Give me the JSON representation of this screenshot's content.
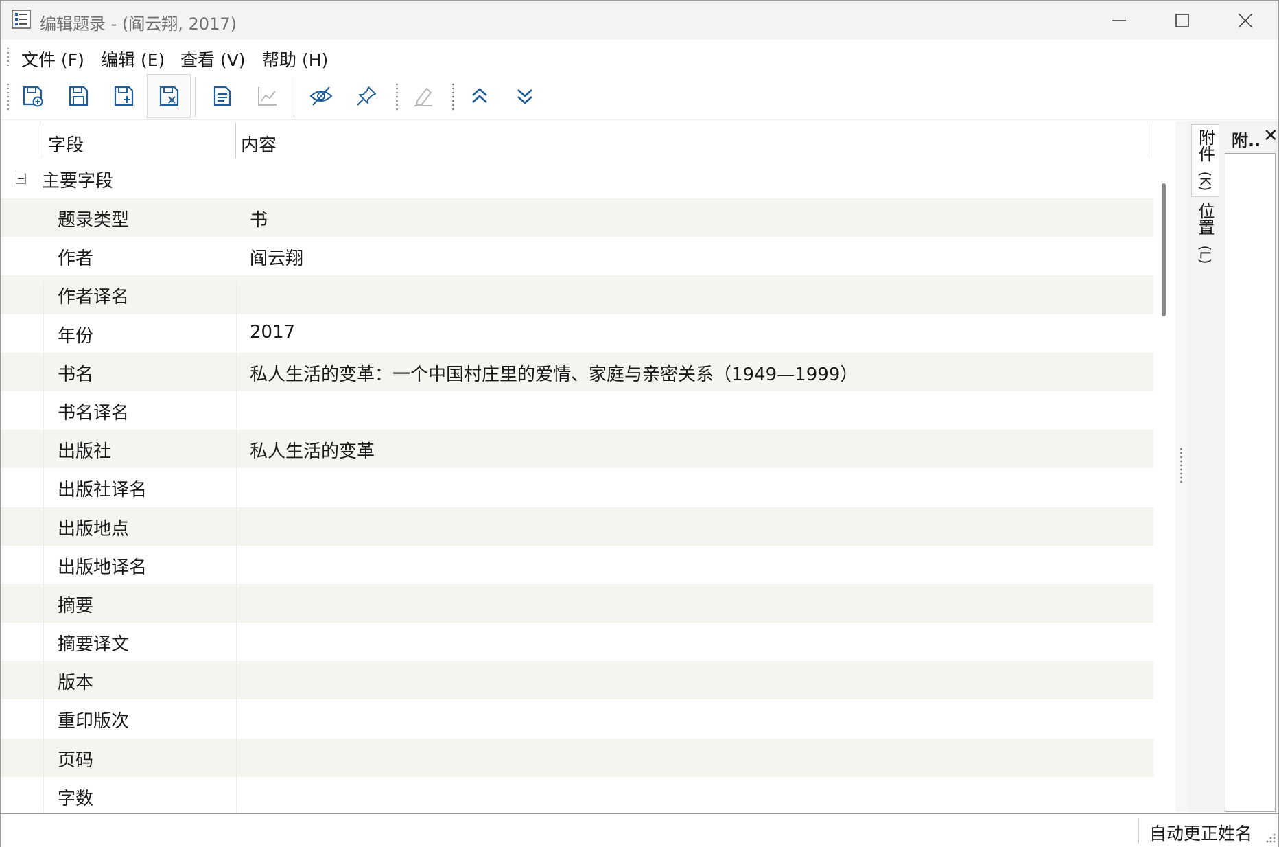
{
  "window": {
    "title": "编辑题录 - (阎云翔, 2017)"
  },
  "menu": {
    "items": [
      "文件 (F)",
      "编辑 (E)",
      "查看 (V)",
      "帮助 (H)"
    ]
  },
  "toolbar": {
    "icons": [
      "save-new-icon",
      "save-icon",
      "save-copy-icon",
      "save-close-icon",
      "record-list-icon",
      "chart-icon",
      "hide-icon",
      "pin-icon",
      "edit-icon",
      "move-up-icon",
      "move-down-icon"
    ]
  },
  "grid": {
    "columns": [
      "字段",
      "内容"
    ],
    "group": "主要字段",
    "rows": [
      {
        "field": "题录类型",
        "value": "书"
      },
      {
        "field": "作者",
        "value": "阎云翔"
      },
      {
        "field": "作者译名",
        "value": ""
      },
      {
        "field": "年份",
        "value": "2017"
      },
      {
        "field": "书名",
        "value": "私人生活的变革：一个中国村庄里的爱情、家庭与亲密关系（1949—1999）"
      },
      {
        "field": "书名译名",
        "value": ""
      },
      {
        "field": "出版社",
        "value": "私人生活的变革"
      },
      {
        "field": "出版社译名",
        "value": ""
      },
      {
        "field": "出版地点",
        "value": ""
      },
      {
        "field": "出版地译名",
        "value": ""
      },
      {
        "field": "摘要",
        "value": ""
      },
      {
        "field": "摘要译文",
        "value": ""
      },
      {
        "field": "版本",
        "value": ""
      },
      {
        "field": "重印版次",
        "value": ""
      },
      {
        "field": "页码",
        "value": ""
      },
      {
        "field": "字数",
        "value": ""
      }
    ]
  },
  "side_tabs": [
    {
      "label": "附件",
      "key": "(K)"
    },
    {
      "label": "位置",
      "key": "(L)"
    }
  ],
  "attach_panel": {
    "title": "附..",
    "close": "✕"
  },
  "status": {
    "text": "自动更正姓名"
  },
  "colors": {
    "accent": "#1f5d99",
    "row_alt": "#f3f5ee",
    "disabled": "#b8b8b8"
  }
}
